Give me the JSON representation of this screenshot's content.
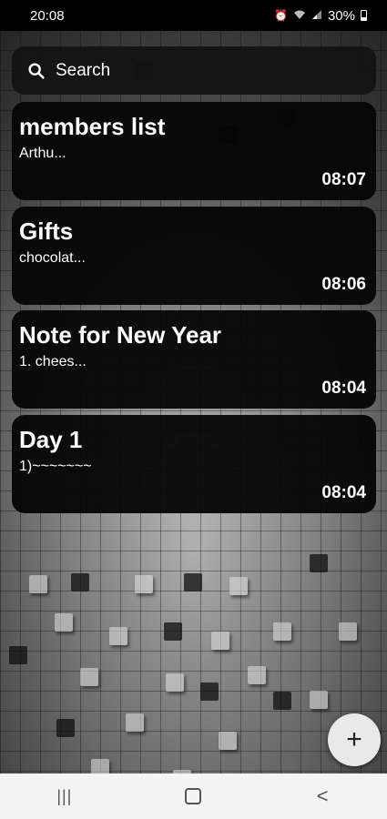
{
  "status_bar": {
    "time": "20:08",
    "battery_text": "30%",
    "icons": [
      "alarm-icon",
      "wifi-icon",
      "signal-icon",
      "battery-icon"
    ]
  },
  "search": {
    "placeholder": "Search",
    "icon": "search-icon"
  },
  "notes": [
    {
      "title": "members list",
      "preview": "Arthu...",
      "time": "08:07"
    },
    {
      "title": "Gifts",
      "preview": "chocolat...",
      "time": "08:06"
    },
    {
      "title": "Note for New Year",
      "preview": "1. chees...",
      "time": "08:04"
    },
    {
      "title": "Day 1",
      "preview": "1)~~~~~~~",
      "time": "08:04"
    }
  ],
  "fab": {
    "label": "+",
    "icon": "add-icon"
  },
  "nav_bar": {
    "recents": "|||",
    "home": "○",
    "back": "<"
  },
  "colors": {
    "card_bg": "#050505",
    "fab_bg": "#e9e9e9",
    "nav_bg": "#f4f4f4"
  }
}
